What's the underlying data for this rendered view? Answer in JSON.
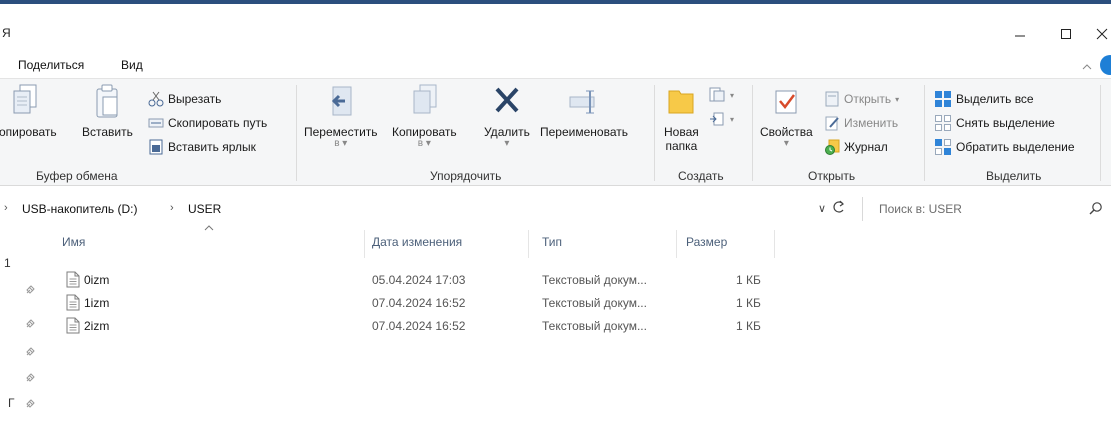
{
  "window": {
    "title_fragment": "Я",
    "minimize_glyph": "—",
    "maximize_glyph": "☐",
    "close_glyph": "✕"
  },
  "menu": {
    "share": "Поделиться",
    "view": "Вид",
    "collapse_glyph": "^"
  },
  "ribbon": {
    "clipboard": {
      "copy": "Копировать",
      "paste": "Вставить",
      "cut": "Вырезать",
      "copy_path": "Скопировать путь",
      "paste_shortcut": "Вставить ярлык",
      "label": "Буфер обмена"
    },
    "organize": {
      "move": "Переместить",
      "move_sub": "в ▾",
      "copy_to": "Копировать",
      "copy_to_sub": "в ▾",
      "delete": "Удалить",
      "delete_sub": "▾",
      "rename": "Переименовать",
      "label": "Упорядочить"
    },
    "create": {
      "new_folder_line1": "Новая",
      "new_folder_line2": "папка",
      "label": "Создать"
    },
    "open": {
      "properties": "Свойства",
      "properties_sub": "▾",
      "open": "Открыть",
      "open_caret": "▾",
      "edit": "Изменить",
      "history": "Журнал",
      "label": "Открыть"
    },
    "select": {
      "select_all": "Выделить все",
      "select_none": "Снять выделение",
      "invert": "Обратить выделение",
      "label": "Выделить"
    }
  },
  "address": {
    "lead_arrow": "›",
    "segments": [
      "USB-накопитель (D:)",
      "USER"
    ],
    "separator": "›",
    "dropdown_glyph": "∨",
    "search_placeholder": "Поиск в: USER"
  },
  "nav": {
    "frag1": "1",
    "frag2": "Г"
  },
  "columns": {
    "name": "Имя",
    "sort_indicator": "^",
    "date": "Дата изменения",
    "type": "Тип",
    "size": "Размер"
  },
  "files": [
    {
      "name": "0izm",
      "date": "05.04.2024 17:03",
      "type": "Текстовый докум...",
      "size": "1 КБ"
    },
    {
      "name": "1izm",
      "date": "07.04.2024 16:52",
      "type": "Текстовый докум...",
      "size": "1 КБ"
    },
    {
      "name": "2izm",
      "date": "07.04.2024 16:52",
      "type": "Текстовый докум...",
      "size": "1 КБ"
    }
  ],
  "colors": {
    "accent": "#1e7fd6",
    "header_text": "#4c607a",
    "ribbon_bg": "#f5f6f7"
  }
}
